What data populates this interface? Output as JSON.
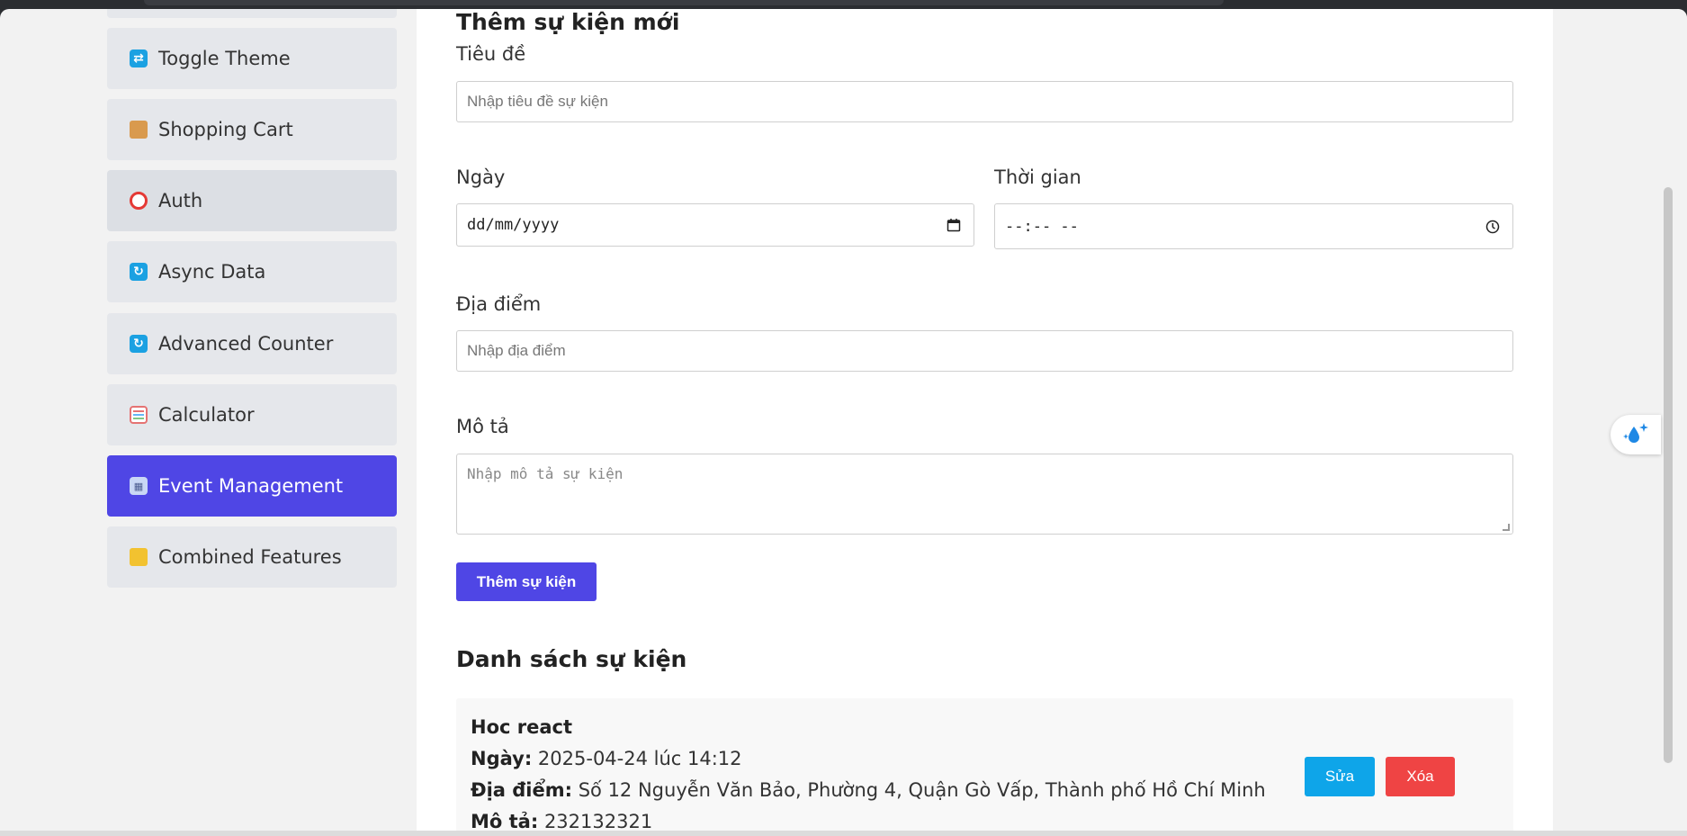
{
  "sidebar": {
    "items": [
      {
        "label": "Toggle Theme",
        "icon": "toggle-icon"
      },
      {
        "label": "Shopping Cart",
        "icon": "package-icon"
      },
      {
        "label": "Auth",
        "icon": "target-icon"
      },
      {
        "label": "Async Data",
        "icon": "refresh-icon"
      },
      {
        "label": "Advanced Counter",
        "icon": "refresh-icon"
      },
      {
        "label": "Calculator",
        "icon": "abacus-icon"
      },
      {
        "label": "Event Management",
        "icon": "calendar-icon"
      },
      {
        "label": "Combined Features",
        "icon": "lock-icon"
      }
    ],
    "active": "Event Management"
  },
  "form": {
    "heading": "Thêm sự kiện mới",
    "title_label": "Tiêu đề",
    "title_placeholder": "Nhập tiêu đề sự kiện",
    "date_label": "Ngày",
    "date_value": "dd/mm/yyyy",
    "time_label": "Thời gian",
    "time_value": "--:-- --",
    "location_label": "Địa điểm",
    "location_placeholder": "Nhập địa điểm",
    "description_label": "Mô tả",
    "description_placeholder": "Nhập mô tả sự kiện",
    "submit_label": "Thêm sự kiện"
  },
  "list": {
    "heading": "Danh sách sự kiện",
    "events": [
      {
        "title": "Hoc react",
        "date_label": "Ngày:",
        "date_value": "2025-04-24 lúc 14:12",
        "location_label": "Địa điểm:",
        "location_value": "Số 12 Nguyễn Văn Bảo, Phường 4, Quận Gò Vấp, Thành phố Hồ Chí Minh",
        "description_label": "Mô tả:",
        "description_value": "232132321",
        "edit_label": "Sửa",
        "delete_label": "Xóa"
      }
    ]
  },
  "colors": {
    "primary": "#4f46e5",
    "edit": "#0ea5e9",
    "delete": "#ef4444",
    "nav_bg": "#e5e7eb"
  }
}
